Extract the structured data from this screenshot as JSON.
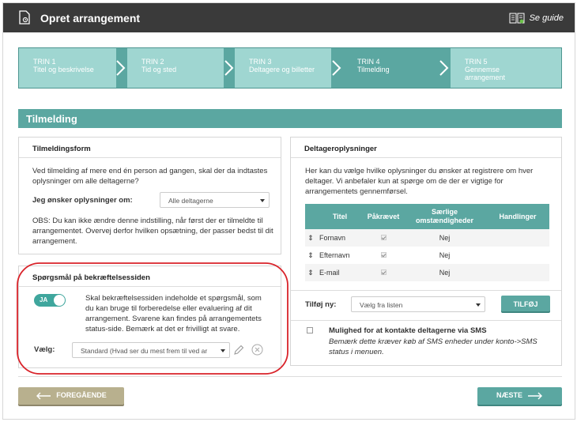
{
  "header": {
    "title": "Opret arrangement",
    "guide_label": "Se guide"
  },
  "steps": [
    {
      "label": "TRIN 1",
      "sub1": "Titel og beskrivelse",
      "sub2": ""
    },
    {
      "label": "TRIN 2",
      "sub1": "Tid og sted",
      "sub2": ""
    },
    {
      "label": "TRIN 3",
      "sub1": "Deltagere og billetter",
      "sub2": ""
    },
    {
      "label": "TRIN 4",
      "sub1": "Tilmelding",
      "sub2": ""
    },
    {
      "label": "TRIN 5",
      "sub1": "Gennemse",
      "sub2": "arrangement"
    }
  ],
  "section": {
    "title": "Tilmelding"
  },
  "tilmeldingsform": {
    "title": "Tilmeldingsform",
    "intro": "Ved tilmelding af mere end én person ad gangen, skal der da indtastes oplysninger om alle deltagerne?",
    "field_label": "Jeg ønsker oplysninger om:",
    "select_value": "Alle deltagerne",
    "note": "OBS: Du kan ikke ændre denne indstilling, når først der er tilmeldte til arrangementet. Overvej derfor hvilken opsætning, der passer bedst til dit arrangement."
  },
  "questions": {
    "title": "Spørgsmål på bekræftelsessiden",
    "toggle_label": "JA",
    "text": "Skal bekræftelsessiden indeholde et spørgsmål, som du kan bruge til forberedelse eller evaluering af dit arrangement. Svarene kan findes på arrangementets status-side. Bemærk at det er frivilligt at svare.",
    "select_label": "Vælg:",
    "select_value": "Standard (Hvad ser du mest frem til ved ar"
  },
  "deltager": {
    "title": "Deltageroplysninger",
    "intro": "Her kan du vælge hvilke oplysninger du ønsker at registrere om hver deltager. Vi anbefaler kun at spørge om de der er vigtige for arrangementets gennemførsel.",
    "columns": [
      "Titel",
      "Påkrævet",
      "Særlige omstændigheder",
      "Handlinger"
    ],
    "rows": [
      {
        "title": "Fornavn",
        "special": "Nej"
      },
      {
        "title": "Efternavn",
        "special": "Nej"
      },
      {
        "title": "E-mail",
        "special": "Nej"
      }
    ],
    "add_label": "Tilføj ny:",
    "add_select": "Vælg fra listen",
    "add_button": "TILFØJ",
    "sms_title": "Mulighed for at kontakte deltagerne via SMS",
    "sms_note": "Bemærk dette kræver køb af SMS enheder under konto->SMS status i menuen."
  },
  "nav": {
    "prev": "FOREGÅENDE",
    "next": "NÆSTE"
  },
  "colors": {
    "accent": "#5ba7a1",
    "step_inactive": "#9fd6d1",
    "header": "#3a3a3a",
    "prev_button": "#b8b08e",
    "highlight": "#d9232a"
  }
}
